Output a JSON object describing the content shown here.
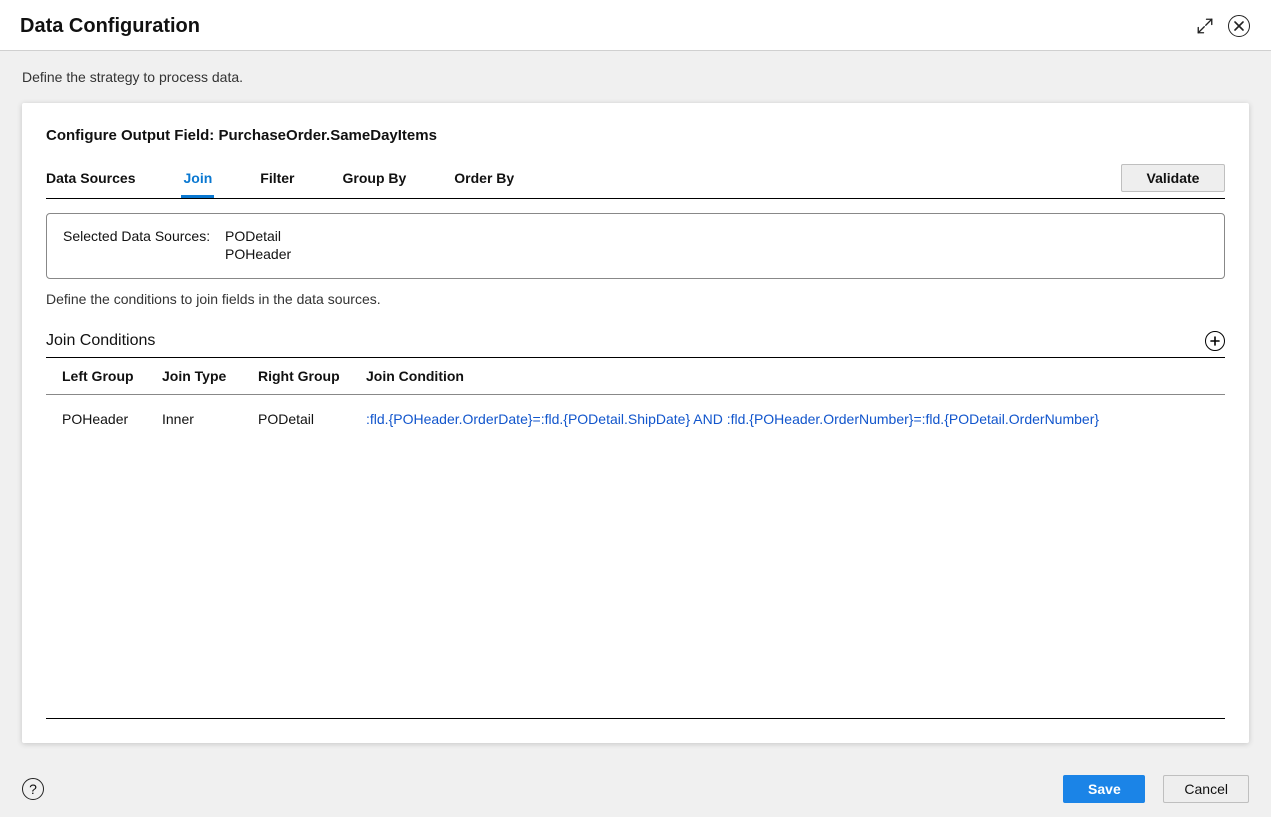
{
  "header": {
    "title": "Data Configuration"
  },
  "description": "Define the strategy to process data.",
  "card": {
    "title_prefix": "Configure Output Field: ",
    "title_value": "PurchaseOrder.SameDayItems",
    "tabs": {
      "data_sources": "Data Sources",
      "join": "Join",
      "filter": "Filter",
      "group_by": "Group By",
      "order_by": "Order By"
    },
    "validate_label": "Validate",
    "sources": {
      "label": "Selected Data Sources:",
      "items": [
        "PODetail",
        "POHeader"
      ]
    },
    "instruction": "Define the conditions to join fields in the data sources.",
    "join_conditions": {
      "title": "Join Conditions",
      "columns": {
        "left_group": "Left Group",
        "join_type": "Join Type",
        "right_group": "Right Group",
        "join_condition": "Join Condition"
      },
      "rows": [
        {
          "left_group": "POHeader",
          "join_type": "Inner",
          "right_group": "PODetail",
          "join_condition": ":fld.{POHeader.OrderDate}=:fld.{PODetail.ShipDate} AND :fld.{POHeader.OrderNumber}=:fld.{PODetail.OrderNumber}"
        }
      ]
    }
  },
  "footer": {
    "save_label": "Save",
    "cancel_label": "Cancel"
  }
}
